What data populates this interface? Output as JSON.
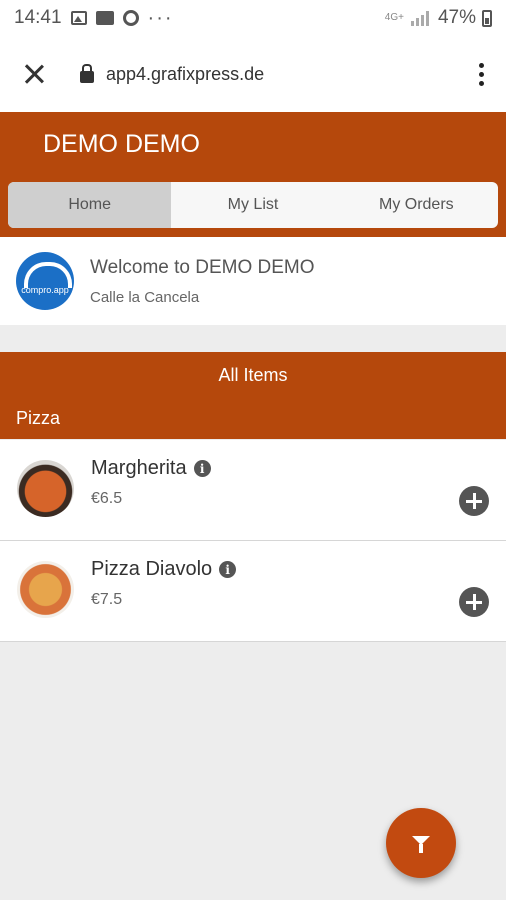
{
  "status_bar": {
    "time": "14:41",
    "network": "4G+",
    "battery": "47%"
  },
  "browser": {
    "url": "app4.grafixpress.de"
  },
  "app": {
    "title": "DEMO DEMO",
    "tabs": [
      {
        "label": "Home",
        "active": true
      },
      {
        "label": "My List",
        "active": false
      },
      {
        "label": "My Orders",
        "active": false
      }
    ],
    "accent_color": "#b5480c"
  },
  "welcome": {
    "logo_text": "compro.app",
    "title": "Welcome to DEMO DEMO",
    "subtitle": "Calle la Cancela"
  },
  "section": {
    "title": "All Items",
    "category": "Pizza"
  },
  "items": [
    {
      "name": "Margherita",
      "price": "€6.5"
    },
    {
      "name": "Pizza Diavolo",
      "price": "€7.5"
    }
  ]
}
